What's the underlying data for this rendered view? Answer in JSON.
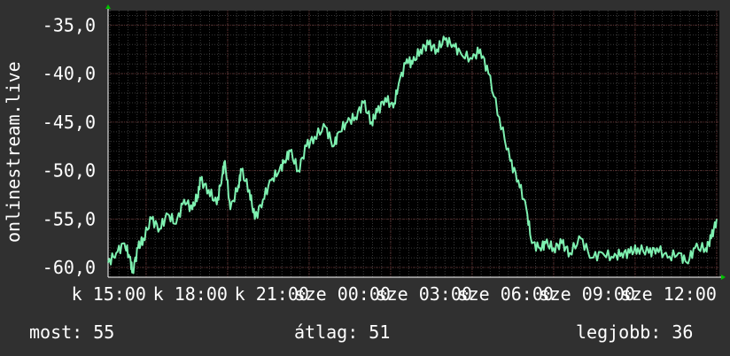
{
  "chart_data": {
    "type": "line",
    "ylabel": "onlinestream.live",
    "ylim": [
      -61,
      -33.5
    ],
    "y_ticks": [
      -35,
      -40,
      -45,
      -50,
      -55,
      -60
    ],
    "y_tick_labels": [
      "-35,0",
      "-40,0",
      "-45,0",
      "-50,0",
      "-55,0",
      "-60,0"
    ],
    "x_tick_labels": [
      "k 15:00",
      "k 18:00",
      "k 21:00",
      "sze 00:00",
      "sze 03:00",
      "sze 06:00",
      "sze 09:00",
      "sze 12:00"
    ],
    "x_hours_start": 13.6,
    "x_hours_end": 36.1,
    "grid": true,
    "colors": {
      "line": "#7ef0b0",
      "background": "#000000",
      "grid": "#5a2a2a",
      "axis_arrow": "#00c000"
    },
    "series": [
      {
        "x": [
          13.6,
          13.9,
          14.2,
          14.4,
          14.5,
          14.7,
          14.9,
          15.2,
          15.5,
          15.8,
          16.1,
          16.4,
          16.7,
          16.9,
          17.0,
          17.3,
          17.6,
          17.8,
          17.9,
          18.1,
          18.4,
          18.5,
          18.8,
          19.0,
          19.3,
          19.6,
          19.9,
          20.1,
          20.3,
          20.6,
          20.9,
          21.2,
          21.6,
          21.9,
          22.1,
          22.4,
          22.7,
          23.0,
          23.3,
          23.5,
          23.8,
          24.1,
          24.3,
          24.6,
          24.8,
          25.1,
          25.4,
          25.7,
          26.0,
          26.3,
          26.6,
          27.0,
          27.3,
          27.6,
          28.0,
          28.4,
          28.7,
          29.0,
          29.2,
          29.5,
          29.7,
          30.0,
          30.3,
          30.6,
          31.0,
          31.4,
          31.8,
          32.2,
          32.5,
          32.8,
          33.1,
          33.5,
          33.8,
          34.2,
          34.6,
          34.9,
          35.2,
          35.6,
          35.8,
          36.0
        ],
        "y": [
          -59.5,
          -58.5,
          -57.5,
          -59.0,
          -60.5,
          -58.0,
          -57.0,
          -55.0,
          -56.0,
          -54.5,
          -55.5,
          -53.0,
          -54.0,
          -52.5,
          -51.0,
          -52.0,
          -53.5,
          -50.5,
          -49.0,
          -54.0,
          -51.5,
          -50.0,
          -52.0,
          -55.0,
          -53.0,
          -51.0,
          -50.0,
          -49.0,
          -48.0,
          -50.0,
          -47.5,
          -46.5,
          -45.5,
          -47.5,
          -46.0,
          -45.0,
          -44.5,
          -43.0,
          -45.0,
          -44.0,
          -42.5,
          -43.5,
          -41.0,
          -38.5,
          -39.0,
          -37.5,
          -37.0,
          -37.5,
          -36.5,
          -37.0,
          -38.0,
          -38.5,
          -37.5,
          -40.0,
          -44.5,
          -49.0,
          -51.0,
          -54.0,
          -57.5,
          -58.0,
          -57.5,
          -58.0,
          -57.5,
          -58.5,
          -57.0,
          -59.0,
          -58.5,
          -59.0,
          -58.5,
          -58.5,
          -58.0,
          -58.5,
          -58.0,
          -59.0,
          -58.5,
          -59.5,
          -58.0,
          -58.0,
          -57.0,
          -55.0
        ]
      }
    ]
  },
  "stats": {
    "current": "most: 55",
    "average": "átlag: 51",
    "best": "legjobb: 36"
  }
}
